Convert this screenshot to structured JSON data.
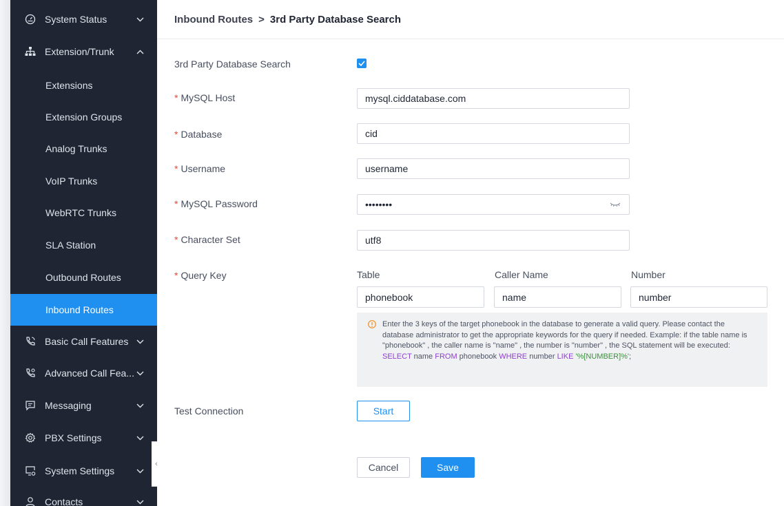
{
  "sidebar": {
    "top_items": [
      {
        "label": "System Status",
        "icon": "gauge-icon"
      },
      {
        "label": "Extension/Trunk",
        "icon": "sitemap-icon"
      }
    ],
    "sub_items": [
      {
        "label": "Extensions"
      },
      {
        "label": "Extension Groups"
      },
      {
        "label": "Analog Trunks"
      },
      {
        "label": "VoIP Trunks"
      },
      {
        "label": "WebRTC Trunks"
      },
      {
        "label": "SLA Station"
      },
      {
        "label": "Outbound Routes"
      },
      {
        "label": "Inbound Routes",
        "active": true
      }
    ],
    "bottom_items": [
      {
        "label": "Basic Call Features",
        "icon": "phone-icon"
      },
      {
        "label": "Advanced Call Fea...",
        "icon": "phone-settings-icon"
      },
      {
        "label": "Messaging",
        "icon": "message-icon"
      },
      {
        "label": "PBX Settings",
        "icon": "gear-icon"
      },
      {
        "label": "System Settings",
        "icon": "monitor-gear-icon"
      },
      {
        "label": "Contacts",
        "icon": "contact-icon"
      }
    ],
    "collapse_glyph": "‹"
  },
  "header": {
    "parent": "Inbound Routes",
    "separator": ">",
    "current": "3rd Party Database Search"
  },
  "form": {
    "enable_label": "3rd Party Database Search",
    "enabled": true,
    "host_label": "MySQL Host",
    "host_value": "mysql.ciddatabase.com",
    "database_label": "Database",
    "database_value": "cid",
    "username_label": "Username",
    "username_value": "username",
    "password_label": "MySQL Password",
    "password_value": "••••••••",
    "charset_label": "Character Set",
    "charset_value": "utf8",
    "query_key_label": "Query Key",
    "required_mark": "*",
    "columns": [
      "Table",
      "Caller Name",
      "Number"
    ],
    "column_values": [
      "phonebook",
      "name",
      "number"
    ],
    "test_label": "Test Connection"
  },
  "info": {
    "text_before": "Enter the 3 keys of the target phonebook in the database to generate a valid query. Please contact the database administrator to get the appropriate keywords for the query if needed. Example: if the table name is \"phonebook\" , the caller name is \"name\" , the number is \"number\" , the SQL statement will be executed: ",
    "kw_select": "SELECT",
    "sql_1": " name ",
    "kw_from": "FROM",
    "sql_2": " phonebook ",
    "kw_where": "WHERE",
    "sql_3": " number ",
    "kw_like": "LIKE",
    "sql_value": " '%[NUMBER]%'",
    "sql_end": ";"
  },
  "buttons": {
    "start": "Start",
    "cancel": "Cancel",
    "save": "Save"
  },
  "colors": {
    "accent": "#1f8ff0",
    "sidebar_bg": "#1f2533",
    "required": "#e84a3c",
    "sql_keyword": "#8e3fd0",
    "sql_value": "#3c8f3c"
  }
}
